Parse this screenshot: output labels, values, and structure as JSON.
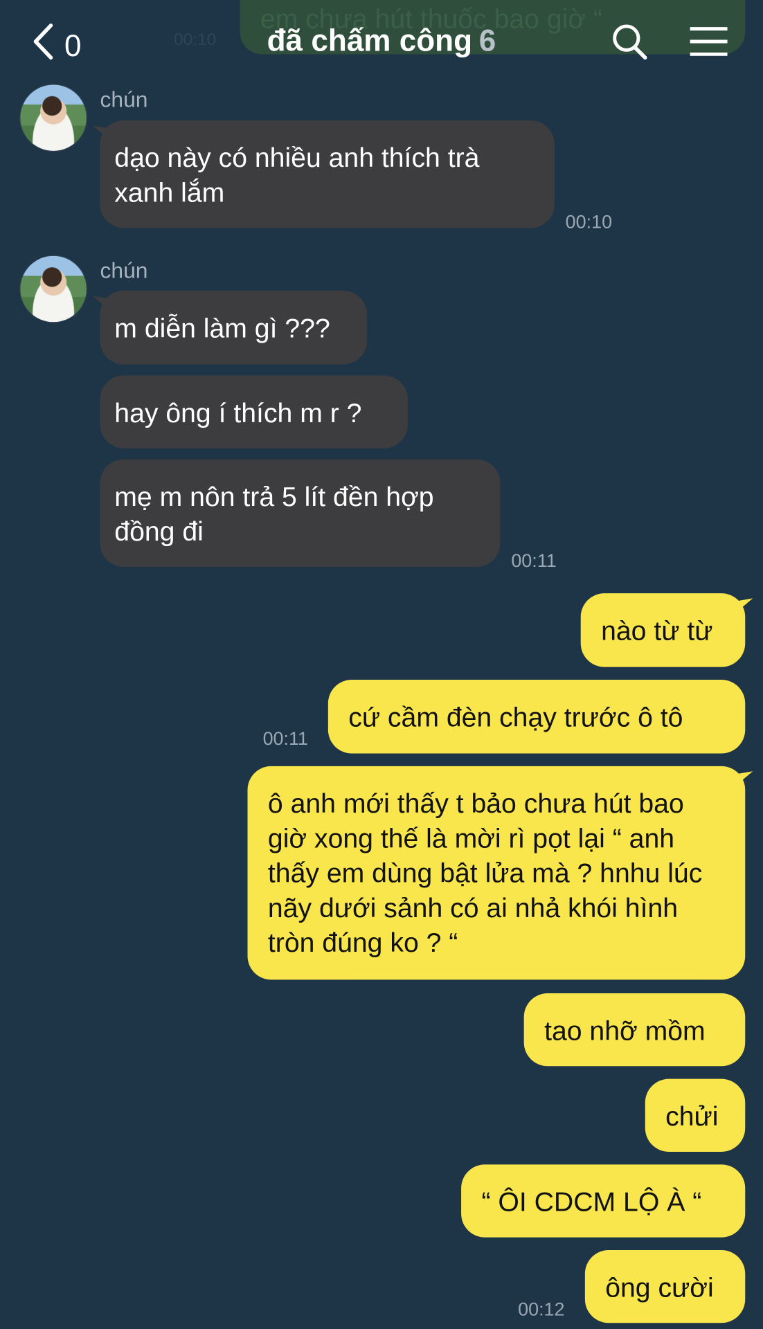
{
  "header": {
    "back_count": "0",
    "title": "đã chấm công",
    "member_count": "6",
    "search_icon": "search-icon",
    "menu_icon": "menu-icon"
  },
  "ghost": {
    "text": "em chưa hút thuốc bao giờ “",
    "time": "00:10"
  },
  "messages": [
    {
      "sender": "chún",
      "text": "dạo này có nhiều anh thích trà xanh lắm",
      "time": "00:10"
    },
    {
      "sender": "chún",
      "text": "m diễn làm gì ???"
    },
    {
      "text": "hay ông í thích m r ?"
    },
    {
      "text": "mẹ m nôn trả 5 lít đền hợp đồng đi",
      "time": "00:11"
    },
    {
      "text": "nào từ từ"
    },
    {
      "text": "cứ cầm đèn chạy trước ô tô",
      "time": "00:11"
    },
    {
      "text": "ô anh mới thấy t bảo chưa hút bao giờ xong thế là mời rì pọt lại “ anh thấy em dùng bật lửa mà ? hnhu lúc nãy dưới sảnh có ai nhả khói hình tròn đúng ko ? “"
    },
    {
      "text": "tao nhỡ mồm"
    },
    {
      "text": "chửi"
    },
    {
      "text": "“ ÔI CDCM LỘ À “"
    },
    {
      "text": "ông cười",
      "time": "00:12"
    }
  ]
}
